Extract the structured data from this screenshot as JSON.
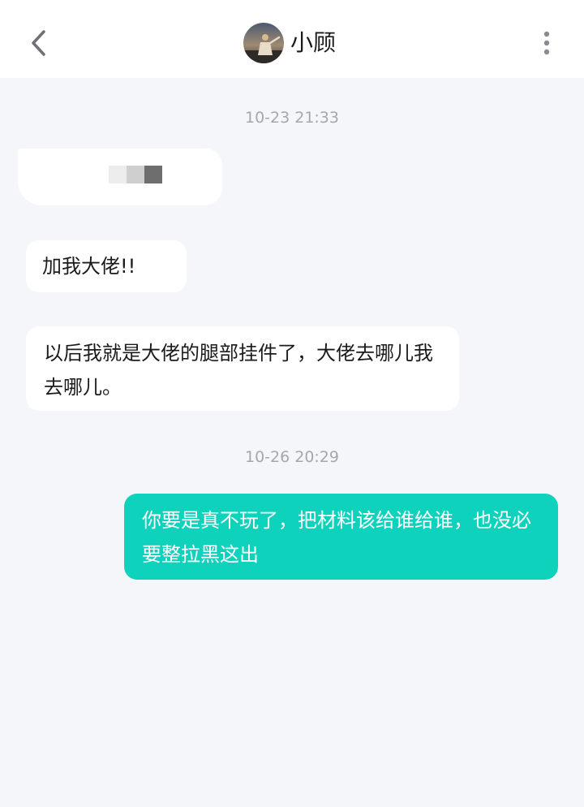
{
  "header": {
    "back_icon": "chevron-left-icon",
    "contact_name": "小顾",
    "more_icon": "more-vertical-icon"
  },
  "colors": {
    "background": "#f4f6f9",
    "header": "#ffffff",
    "received_bubble": "#ffffff",
    "sent_bubble": "#0fd2bd",
    "timestamp": "#a3a8ae"
  },
  "messages": [
    {
      "type": "timestamp",
      "text": "10-23 21:33"
    },
    {
      "type": "received",
      "text": "",
      "redacted": true
    },
    {
      "type": "received",
      "text": "加我大佬!!"
    },
    {
      "type": "received",
      "text": "以后我就是大佬的腿部挂件了，大佬去哪儿我去哪儿。"
    },
    {
      "type": "timestamp",
      "text": "10-26 20:29"
    },
    {
      "type": "sent",
      "text": "你要是真不玩了，把材料该给谁给谁，也没必要整拉黑这出"
    }
  ]
}
